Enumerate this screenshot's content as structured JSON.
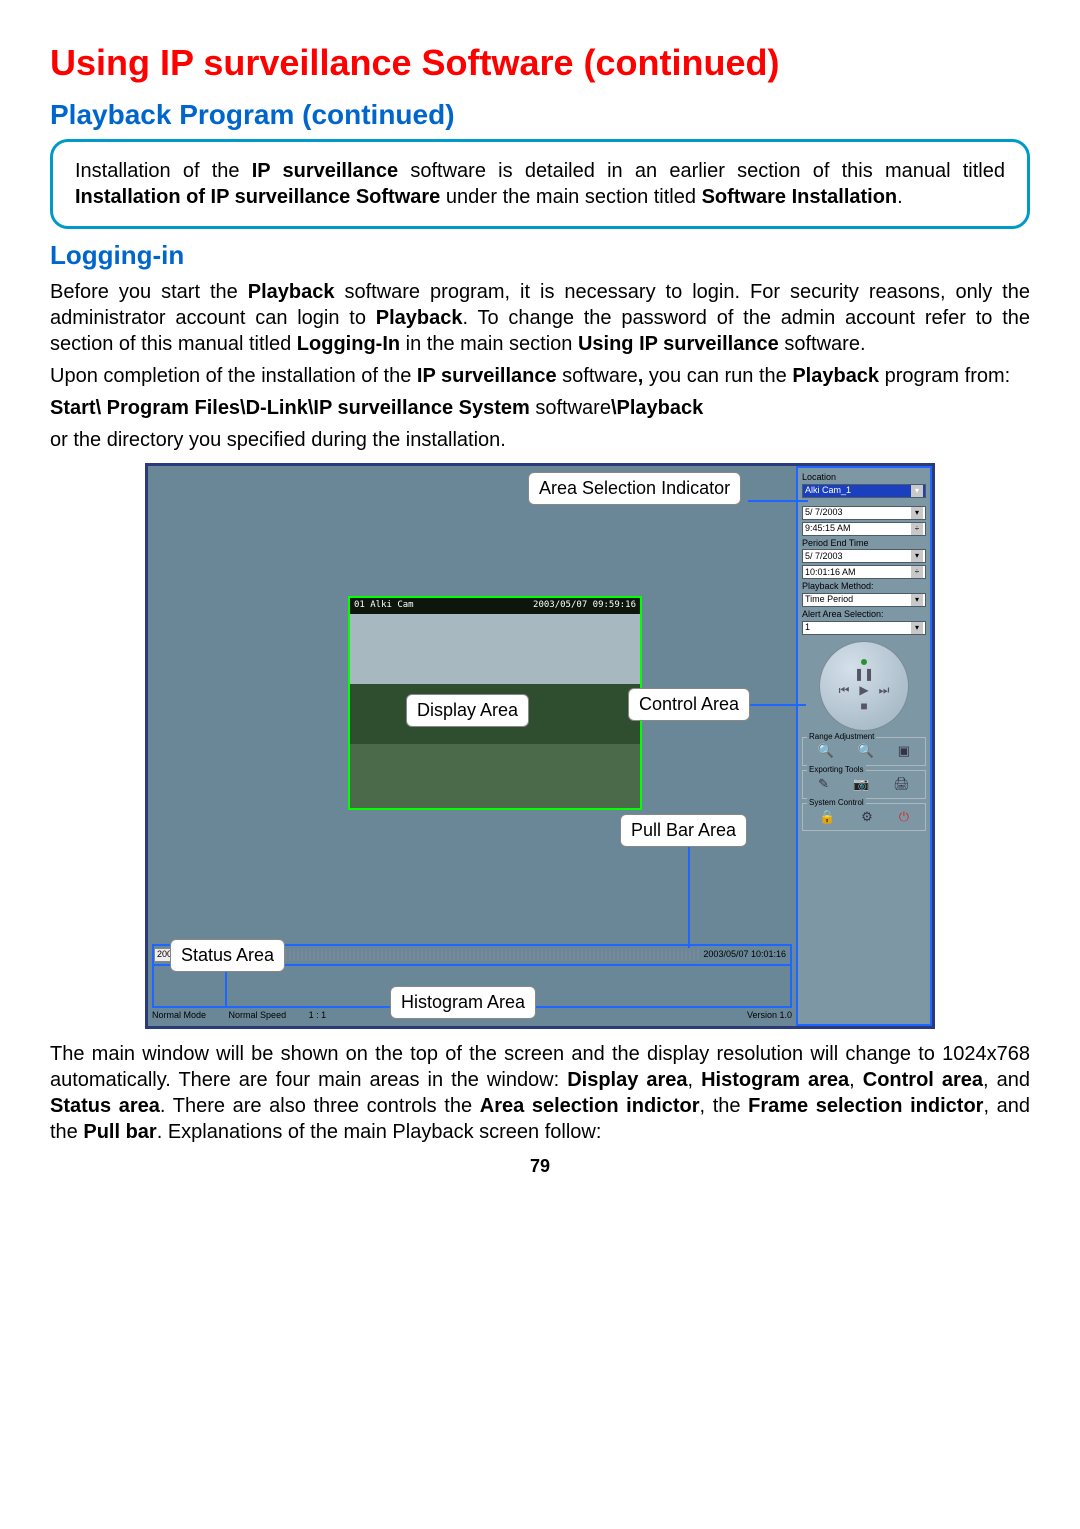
{
  "title": "Using IP surveillance Software (continued)",
  "section": "Playback Program (continued)",
  "note": {
    "t1": "Installation of the ",
    "b1": "IP surveillance",
    "t2": " software is detailed in an earlier section of this manual titled ",
    "b2": "Installation of IP surveillance Software",
    "t3": " under the main section titled ",
    "b3": "Software Installation",
    "t4": "."
  },
  "sub": "Logging-in",
  "p1": {
    "t1": "Before you start the ",
    "b1": "Playback",
    "t2": " software program, it is necessary to login. For security reasons, only the administrator account can login to ",
    "b2": "Playback",
    "t3": ". To change the password of the admin account refer to the section of this manual titled ",
    "b3": "Logging-In",
    "t4": " in the main section ",
    "b4": "Using IP surveillance",
    "t5": " software."
  },
  "p2": {
    "t1": "Upon completion of the installation of the ",
    "b1": "IP surveillance",
    "t2": " software",
    "b2": ",",
    "t3": " you can run the ",
    "b3": "Playback",
    "t4": " program from:"
  },
  "path": {
    "b1": "Start\\ Program Files\\D-Link\\IP surveillance System ",
    "t1": "software",
    "b2": "\\Playback"
  },
  "p3": "or the directory you specified during the installation.",
  "screenshot": {
    "callouts": {
      "area_sel": "Area Selection Indicator",
      "display": "Display Area",
      "control": "Control  Area",
      "pullbar": "Pull Bar  Area",
      "status": "Status Area",
      "histogram": "Histogram Area"
    },
    "video": {
      "cam_label": "01 Alki Cam",
      "timestamp": "2003/05/07 09:59:16"
    },
    "right": {
      "location_label": "Location",
      "location": "Alki Cam_1",
      "date1": "5/ 7/2003",
      "time1": "9:45:15 AM",
      "period_end_label": "Period End Time",
      "date2": "5/ 7/2003",
      "time2": "10:01:16 AM",
      "pb_method_label": "Playback Method:",
      "pb_method": "Time Period",
      "alert_label": "Alert Area Selection:",
      "alert": "1",
      "range_label": "Range Adjustment",
      "export_label": "Exporting Tools",
      "system_label": "System Control"
    },
    "status_row": {
      "tag": "200",
      "timestamp": "2003/05/07 10:01:16"
    },
    "bottom": {
      "mode": "Normal Mode",
      "speed": "Normal Speed",
      "ratio": "1 : 1",
      "version": "Version 1.0"
    }
  },
  "p4": {
    "t1": "The main window will be shown on the top of the screen and the display resolution will change to 1024x768 automatically. There are four main areas in the window: ",
    "b1": "Display area",
    "t2": ", ",
    "b2": "Histogram area",
    "t3": ", ",
    "b3": "Control area",
    "t4": ", and ",
    "b4": "Status area",
    "t5": ". There are also three controls the ",
    "b5": "Area selection indictor",
    "t6": ", the ",
    "b6": "Frame selection indictor",
    "t7": ", and the ",
    "b7": "Pull bar",
    "t8": ". Explanations of the main Playback screen follow:"
  },
  "page_number": "79"
}
